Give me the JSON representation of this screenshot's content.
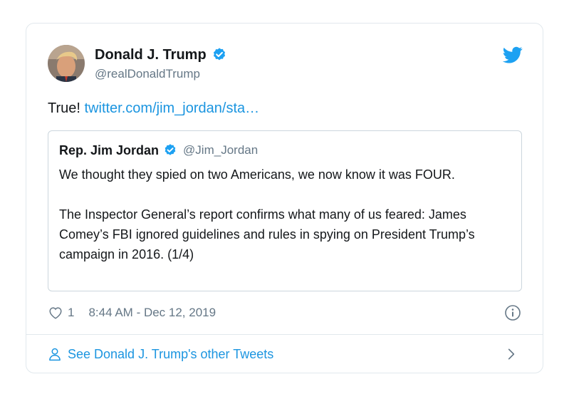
{
  "tweet": {
    "author_name": "Donald J. Trump",
    "author_handle": "@realDonaldTrump",
    "text_prefix": "True! ",
    "link_text": "twitter.com/jim_jordan/sta…",
    "likes": "1",
    "timestamp": "8:44 AM - Dec 12, 2019"
  },
  "quoted_tweet": {
    "author_name": "Rep. Jim Jordan",
    "author_handle": "@Jim_Jordan",
    "paragraph_1": "We thought they spied on two Americans, we now know it was FOUR.",
    "paragraph_2": "The Inspector General’s report confirms what many of us feared: James Comey’s FBI ignored guidelines and rules in spying on President Trump’s campaign in 2016. (1/4)"
  },
  "footer": {
    "other_tweets_label": "See Donald J. Trump's other Tweets"
  },
  "icons": {
    "brand": "twitter-bird-icon",
    "verified": "verified-badge-icon",
    "like": "heart-icon",
    "info": "info-icon",
    "profile": "person-icon",
    "more": "chevron-right-icon"
  },
  "colors": {
    "link": "#1b95e0",
    "verified": "#1da1f2",
    "muted": "#657786",
    "border": "#e1e8ed"
  }
}
